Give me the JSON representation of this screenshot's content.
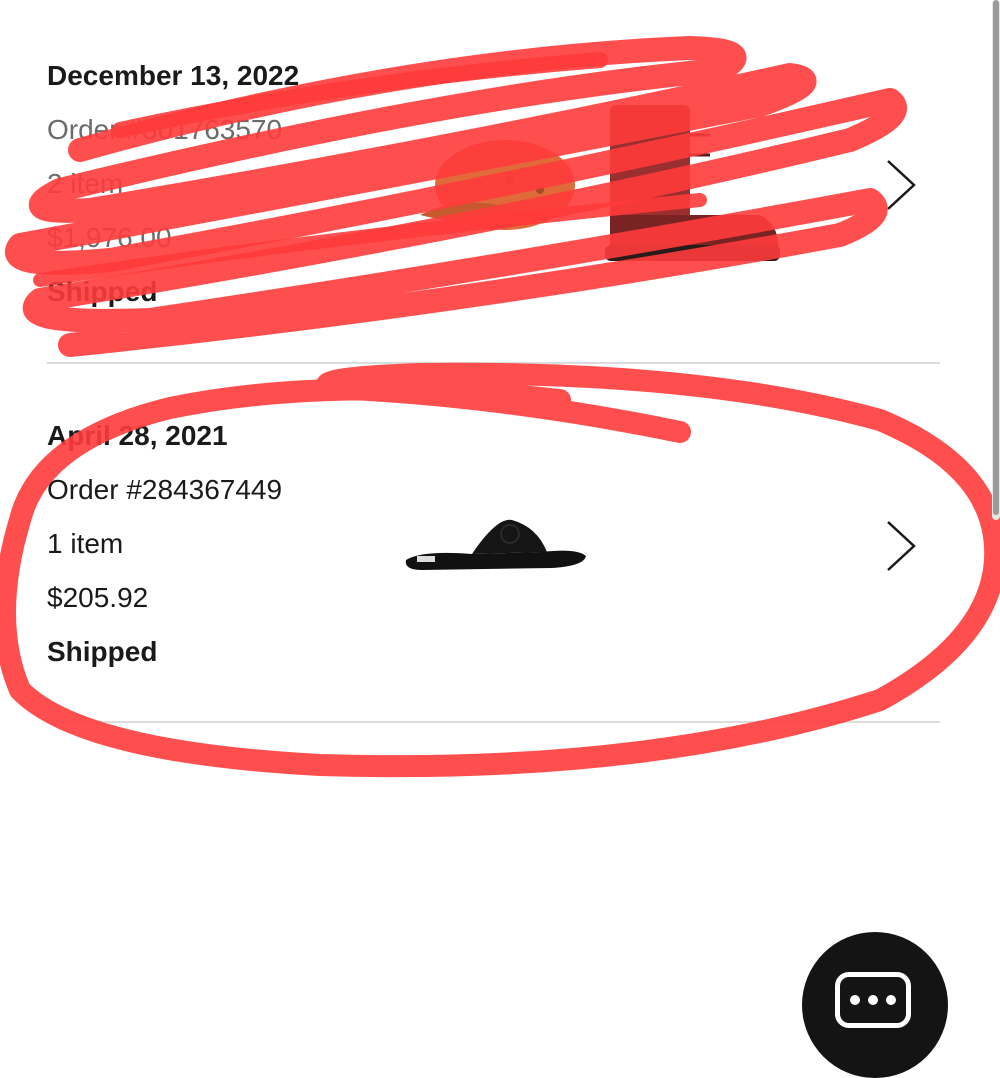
{
  "orders": [
    {
      "date": "December 13, 2022",
      "order_number": "Order #301763570",
      "items": "2 item",
      "total": "$1,976.00",
      "status": "Shipped",
      "thumbnails": [
        "cap-image",
        "boot-image"
      ]
    },
    {
      "date": "April 28, 2021",
      "order_number": "Order #284367449",
      "items": "1 item",
      "total": "$205.92",
      "status": "Shipped",
      "thumbnails": [
        "sandal-image"
      ]
    }
  ],
  "colors": {
    "markup_red": "#ff3b3b",
    "divider": "#dcdcdc",
    "text": "#1a1a1a",
    "fab": "#141414"
  },
  "icons": {
    "order_chevron": "chevron-right-icon",
    "fab": "chat-icon"
  }
}
